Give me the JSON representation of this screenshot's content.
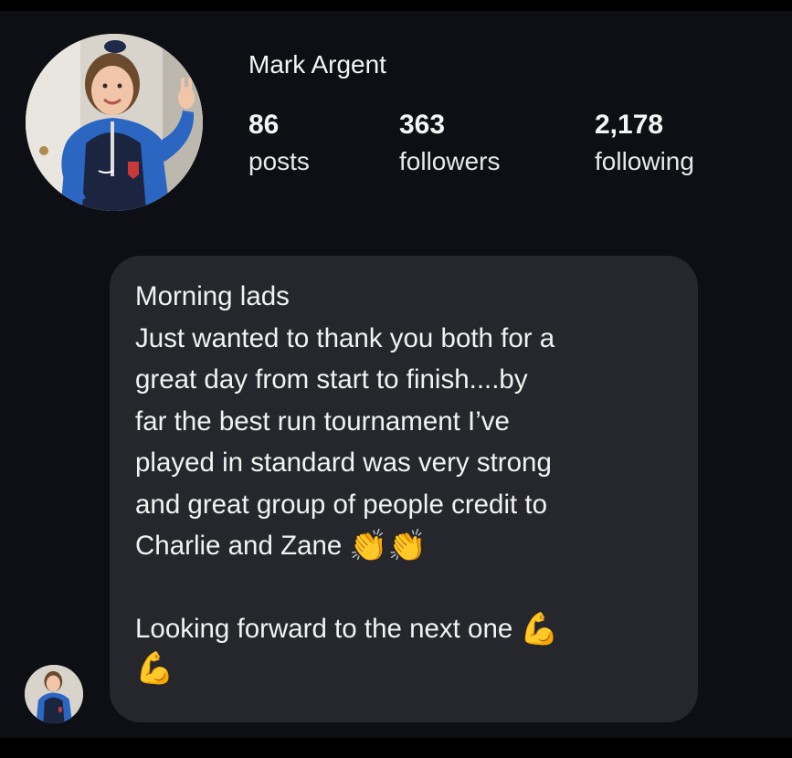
{
  "profile": {
    "name": "Mark Argent",
    "stats": [
      {
        "count": "86",
        "label": "posts"
      },
      {
        "count": "363",
        "label": "followers"
      },
      {
        "count": "2,178",
        "label": "following"
      }
    ]
  },
  "message": {
    "lines": [
      {
        "text": "Morning lads"
      },
      {
        "text": "Just wanted to thank you both for a"
      },
      {
        "text": "great day from start to finish....by"
      },
      {
        "text": "far the best run tournament I’ve"
      },
      {
        "text": "played in standard was very strong"
      },
      {
        "text": "and great group of people credit to"
      },
      {
        "text": "Charlie and Zane",
        "emoji": "👏👏"
      },
      {
        "text": ""
      },
      {
        "text": "Looking forward to the next one",
        "emoji": "💪"
      },
      {
        "text": "",
        "emoji": "💪"
      }
    ]
  },
  "icons": {
    "avatar_large": "profile-photo",
    "avatar_small": "sender-avatar"
  },
  "colors": {
    "background": "#0d0f14",
    "bubble": "#25272c",
    "text": "#f2f2f2"
  }
}
